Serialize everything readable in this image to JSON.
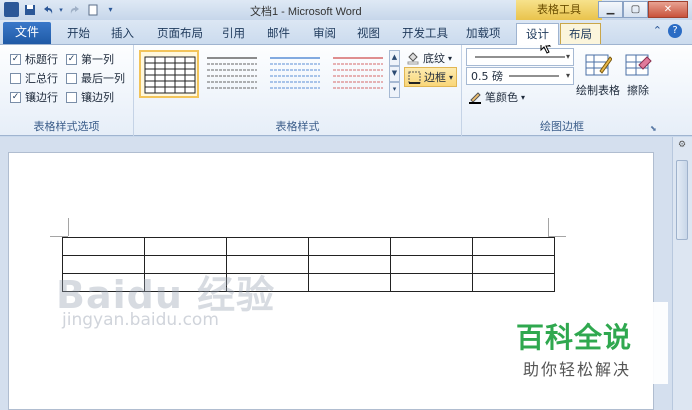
{
  "window": {
    "title": "文档1 - Microsoft Word",
    "context_tab_title": "表格工具",
    "app_icon_letter": "W"
  },
  "tabs": {
    "file": "文件",
    "items": [
      "开始",
      "插入",
      "页面布局",
      "引用",
      "邮件",
      "审阅",
      "视图",
      "开发工具",
      "加载项"
    ],
    "context_tabs": [
      "设计",
      "布局"
    ],
    "active": "设计"
  },
  "options_group": {
    "label": "表格样式选项",
    "checkboxes": [
      {
        "label": "标题行",
        "checked": true
      },
      {
        "label": "第一列",
        "checked": true
      },
      {
        "label": "汇总行",
        "checked": false
      },
      {
        "label": "最后一列",
        "checked": false
      },
      {
        "label": "镶边行",
        "checked": true
      },
      {
        "label": "镶边列",
        "checked": false
      }
    ]
  },
  "styles_group": {
    "label": "表格样式",
    "shading_label": "底纹",
    "border_label": "边框",
    "style_colors": [
      "#222222",
      "#666666",
      "#5b8fd6",
      "#d66a6a"
    ]
  },
  "draw_group": {
    "label": "绘图边框",
    "line_weight": "0.5 磅",
    "pen_color_label": "笔颜色",
    "draw_table_label": "绘制表格",
    "eraser_label": "擦除"
  },
  "watermark": {
    "baidu_text": "Baidu 经验",
    "baidu_sub": "jingyan.baidu.com",
    "brand_title": "百科全说",
    "brand_sub": "助你轻松解决",
    "brand_color": "#2fa84f"
  },
  "table": {
    "rows": 3,
    "cols": 6
  }
}
